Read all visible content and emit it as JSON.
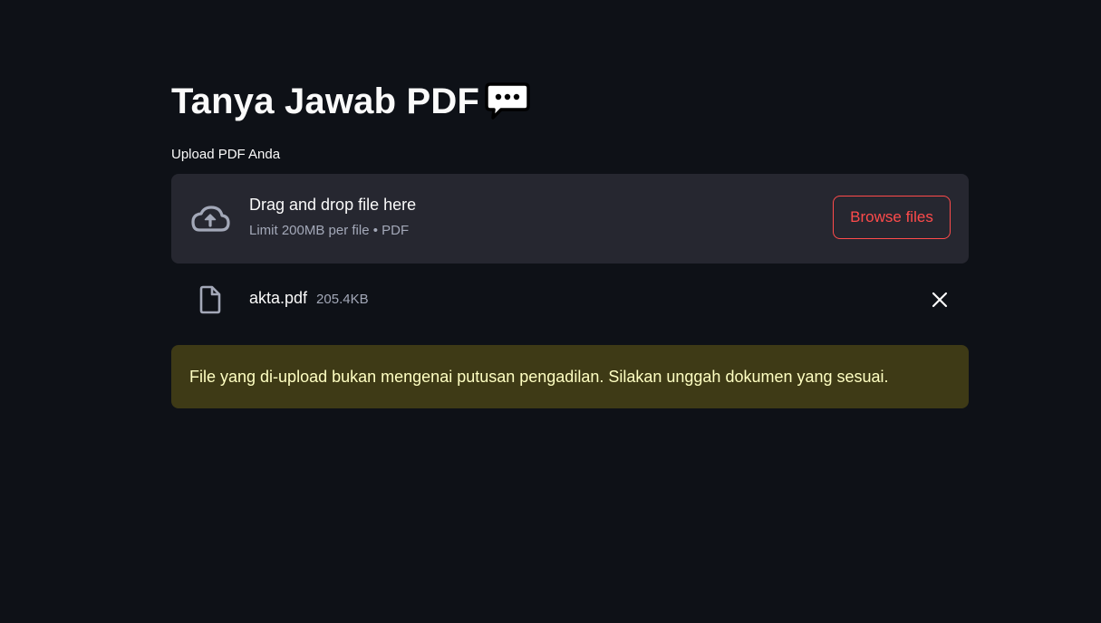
{
  "page": {
    "title": "Tanya Jawab PDF",
    "title_icon": "speech-balloon-icon"
  },
  "uploader": {
    "label": "Upload PDF Anda",
    "drop_text": "Drag and drop file here",
    "limit_text": "Limit 200MB per file • PDF",
    "browse_label": "Browse files",
    "upload_icon": "cloud-upload-icon"
  },
  "uploaded_file": {
    "name": "akta.pdf",
    "size": "205.4KB",
    "icon": "file-icon",
    "remove_icon": "close-icon"
  },
  "alert": {
    "type": "warning",
    "message": "File yang di-upload bukan mengenai putusan pengadilan. Silakan unggah dokumen yang sesuai."
  },
  "colors": {
    "background": "#0e1117",
    "dropzone": "#262730",
    "accent": "#ff4b4b",
    "warning_bg": "#3e3a16",
    "warning_text": "#ffffc2"
  }
}
